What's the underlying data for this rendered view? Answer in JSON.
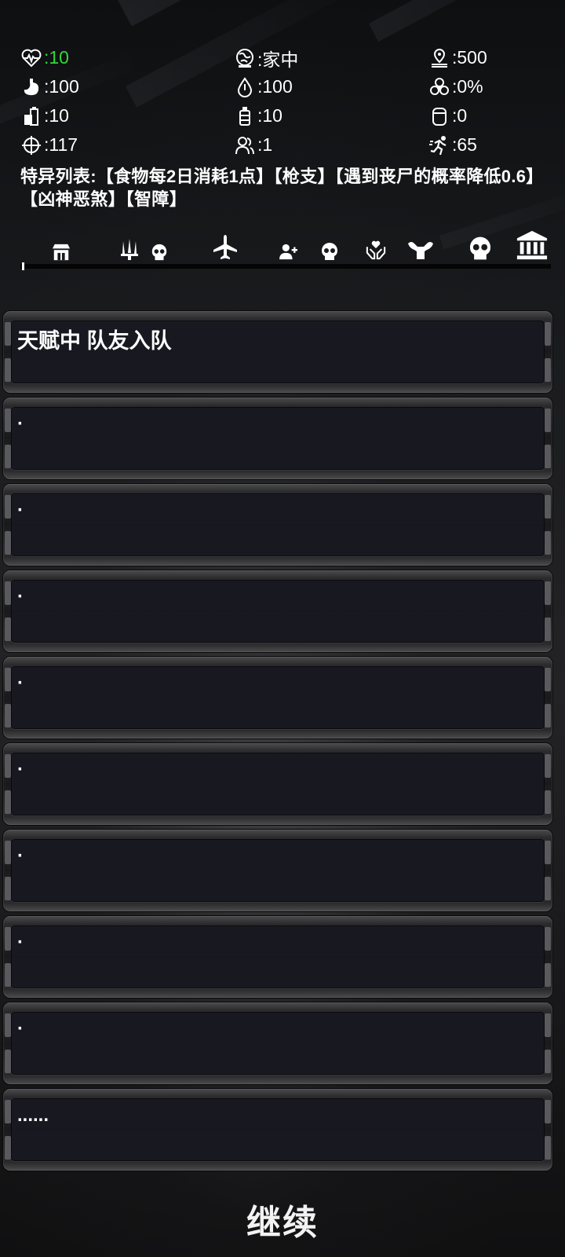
{
  "stats": [
    {
      "icon": "heartbeat-icon",
      "value": ":10",
      "color": "#31d83b"
    },
    {
      "icon": "location-globe-icon",
      "value": ":家中"
    },
    {
      "icon": "map-pin-distance-icon",
      "value": ":500"
    },
    {
      "icon": "stomach-icon",
      "value": ":100"
    },
    {
      "icon": "water-drop-icon",
      "value": ":100"
    },
    {
      "icon": "biohazard-icon",
      "value": ":0%"
    },
    {
      "icon": "food-supplies-icon",
      "value": ":10"
    },
    {
      "icon": "water-bottle-icon",
      "value": ":10"
    },
    {
      "icon": "cylinder-icon",
      "value": ":0"
    },
    {
      "icon": "crosshair-icon",
      "value": ":117"
    },
    {
      "icon": "people-icon",
      "value": ":1"
    },
    {
      "icon": "running-icon",
      "value": ":65"
    }
  ],
  "traits": {
    "text": "特异列表:【食物每2日消耗1点】【枪支】【遇到丧尸的概率降低0.6】【凶神恶煞】【智障】"
  },
  "event_icons": [
    "shop-icon",
    "weapon-icon",
    "skull-icon",
    "airplane-icon",
    "add-person-icon",
    "skull-icon",
    "hands-heart-icon",
    "strength-icon",
    "skull-large-icon",
    "bank-icon"
  ],
  "progress": 0.0,
  "log": [
    "天赋中 队友入队",
    "·",
    "·",
    "·",
    "·",
    "·",
    "·",
    "·",
    "·",
    "......"
  ],
  "continue_label": "继续"
}
